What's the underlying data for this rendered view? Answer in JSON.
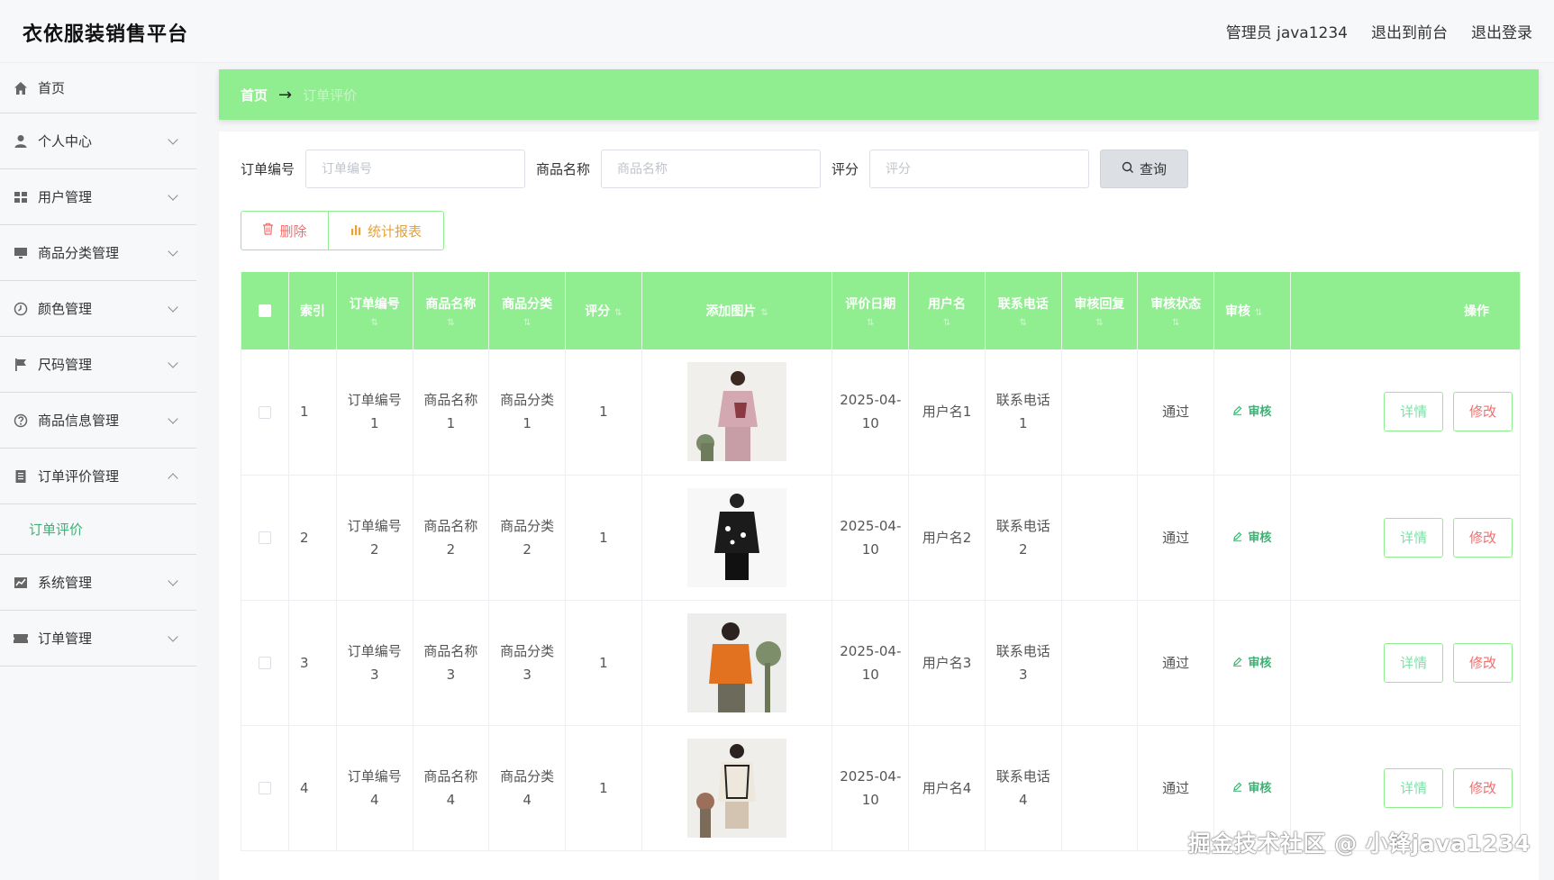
{
  "header": {
    "brand": "衣依服装销售平台",
    "admin": "管理员 java1234",
    "to_front": "退出到前台",
    "logout": "退出登录"
  },
  "sidebar": {
    "items": [
      {
        "label": "首页",
        "icon": "home-icon"
      },
      {
        "label": "个人中心",
        "icon": "user-icon"
      },
      {
        "label": "用户管理",
        "icon": "grid-icon"
      },
      {
        "label": "商品分类管理",
        "icon": "monitor-icon"
      },
      {
        "label": "颜色管理",
        "icon": "clock-icon"
      },
      {
        "label": "尺码管理",
        "icon": "flag-icon"
      },
      {
        "label": "商品信息管理",
        "icon": "info-circle-icon"
      },
      {
        "label": "订单评价管理",
        "icon": "document-icon"
      },
      {
        "label": "系统管理",
        "icon": "chart-icon"
      },
      {
        "label": "订单管理",
        "icon": "ticket-icon"
      }
    ],
    "sub_active": "订单评价"
  },
  "breadcrumb": {
    "home": "首页",
    "current": "订单评价"
  },
  "search": {
    "order_no_label": "订单编号",
    "order_no_placeholder": "订单编号",
    "product_label": "商品名称",
    "product_placeholder": "商品名称",
    "score_label": "评分",
    "score_placeholder": "评分",
    "button": "查询"
  },
  "actions": {
    "delete": "删除",
    "stats": "统计报表"
  },
  "table": {
    "headers": [
      "索引",
      "订单编号",
      "商品名称",
      "商品分类",
      "评分",
      "添加图片",
      "评价日期",
      "用户名",
      "联系电话",
      "审核回复",
      "审核状态",
      "审核",
      "操作"
    ],
    "review_label": "审核",
    "detail_label": "详情",
    "edit_label": "修改",
    "rows": [
      {
        "index": "1",
        "order_a": "订单编号",
        "order_b": "1",
        "name_a": "商品名称",
        "name_b": "1",
        "cat_a": "商品分类",
        "cat_b": "1",
        "score": "1",
        "date_a": "2025-04-",
        "date_b": "10",
        "user": "用户名1",
        "phone_a": "联系电话",
        "phone_b": "1",
        "reply": "",
        "status": "通过"
      },
      {
        "index": "2",
        "order_a": "订单编号",
        "order_b": "2",
        "name_a": "商品名称",
        "name_b": "2",
        "cat_a": "商品分类",
        "cat_b": "2",
        "score": "1",
        "date_a": "2025-04-",
        "date_b": "10",
        "user": "用户名2",
        "phone_a": "联系电话",
        "phone_b": "2",
        "reply": "",
        "status": "通过"
      },
      {
        "index": "3",
        "order_a": "订单编号",
        "order_b": "3",
        "name_a": "商品名称",
        "name_b": "3",
        "cat_a": "商品分类",
        "cat_b": "3",
        "score": "1",
        "date_a": "2025-04-",
        "date_b": "10",
        "user": "用户名3",
        "phone_a": "联系电话",
        "phone_b": "3",
        "reply": "",
        "status": "通过"
      },
      {
        "index": "4",
        "order_a": "订单编号",
        "order_b": "4",
        "name_a": "商品名称",
        "name_b": "4",
        "cat_a": "商品分类",
        "cat_b": "4",
        "score": "1",
        "date_a": "2025-04-",
        "date_b": "10",
        "user": "用户名4",
        "phone_a": "联系电话",
        "phone_b": "4",
        "reply": "",
        "status": "通过"
      }
    ]
  },
  "watermark": "掘金技术社区 @ 小锋java1234",
  "colors": {
    "accent": "#90ee90",
    "link_green": "#3bb273",
    "danger": "#f56c6c",
    "warning": "#e6a23c"
  }
}
